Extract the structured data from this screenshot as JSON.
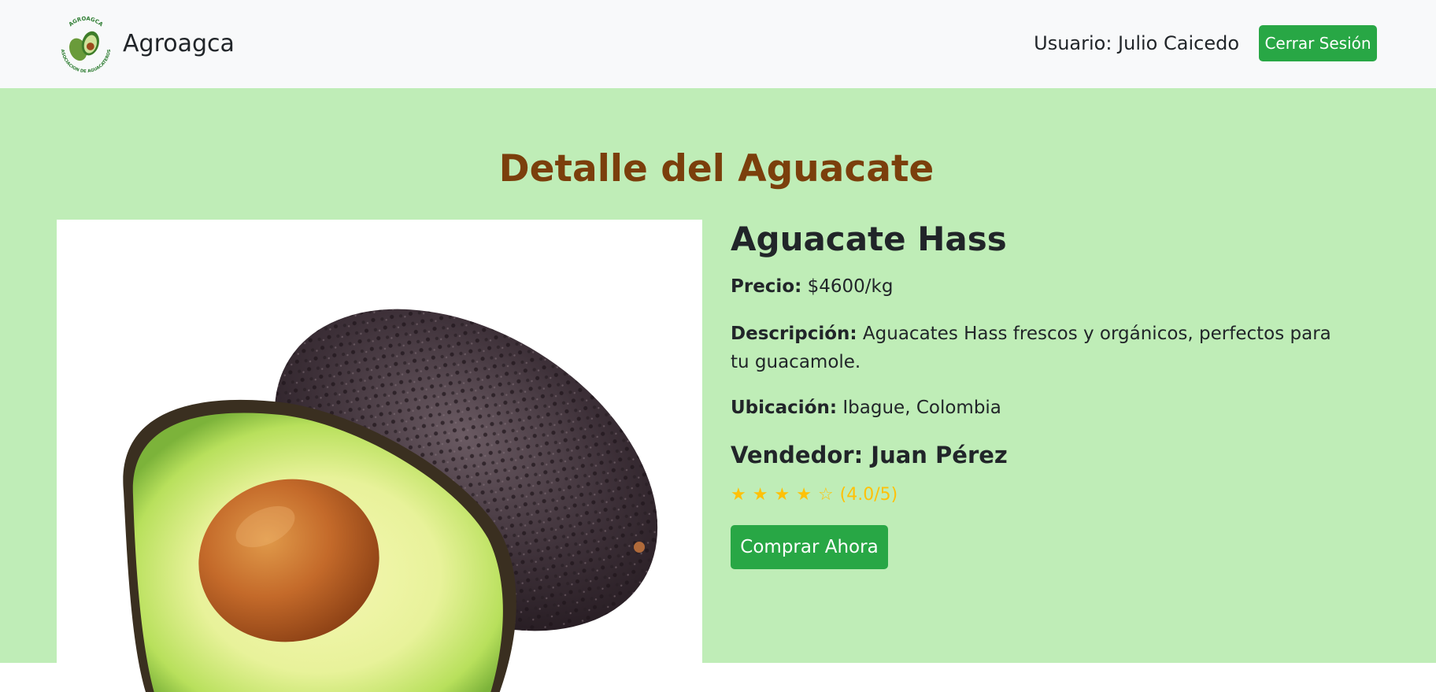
{
  "navbar": {
    "brand_name": "Agroagca",
    "logo_text_top": "AGROAGCA",
    "logo_text_bottom": "ASOCIACION DE AGUACATEROS",
    "user_label": "Usuario: Julio Caicedo",
    "logout_label": "Cerrar Sesión"
  },
  "page": {
    "title": "Detalle del Aguacate"
  },
  "product": {
    "name": "Aguacate Hass",
    "price_label": "Precio:",
    "price_value": "$4600/kg",
    "description_label": "Descripción:",
    "description_value": "Aguacates Hass frescos y orgánicos, perfectos para tu guacamole.",
    "location_label": "Ubicación:",
    "location_value": "Ibague, Colombia",
    "seller": "Vendedor: Juan Pérez",
    "rating": {
      "value": 4,
      "max": 5,
      "text": "(4.0/5)"
    },
    "image_name": "avocado-hass-photo",
    "buy_label": "Comprar Ahora"
  },
  "colors": {
    "navbar_bg": "#f8f9fa",
    "page_bg": "#bfedb7",
    "title_color": "#7b3f0c",
    "button_green": "#28a745",
    "star_color": "#ffc107"
  }
}
